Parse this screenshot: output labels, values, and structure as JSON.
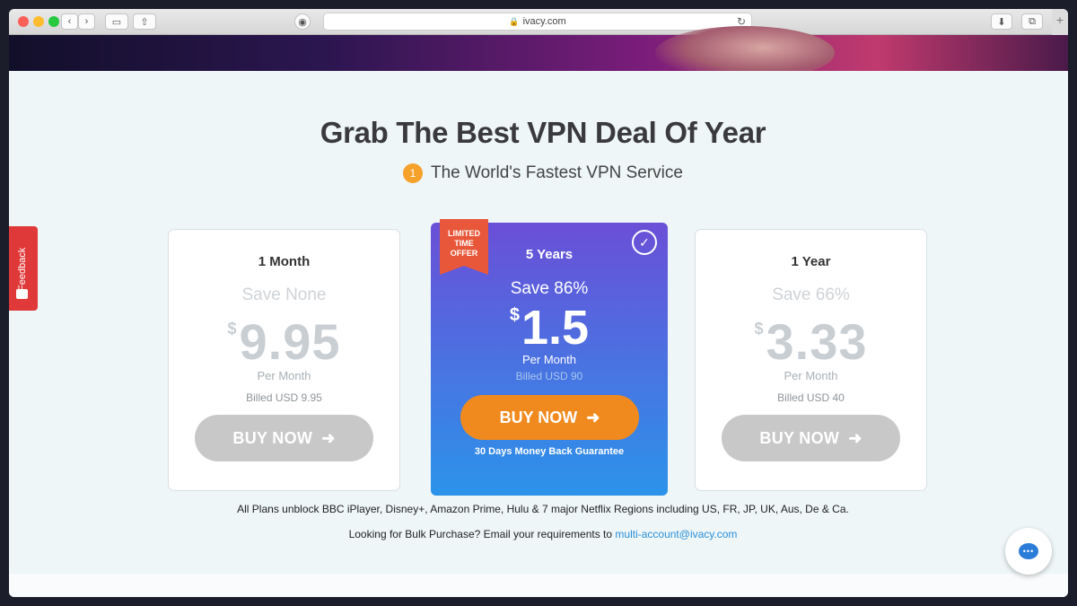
{
  "browser": {
    "url": "ivacy.com",
    "new_tab_label": "+"
  },
  "page": {
    "headline": "Grab The Best VPN Deal Of Year",
    "badge_number": "1",
    "subheadline": "The World's Fastest VPN Service"
  },
  "plans": [
    {
      "period": "1 Month",
      "save": "Save None",
      "currency": "$",
      "price": "9.95",
      "per": "Per Month",
      "billed": "Billed USD 9.95",
      "button": "BUY NOW"
    },
    {
      "period": "5 Years",
      "ribbon": "LIMITED TIME OFFER",
      "save": "Save 86%",
      "currency": "$",
      "price": "1.5",
      "per": "Per Month",
      "billed": "Billed USD 90",
      "button": "BUY NOW",
      "guarantee": "30 Days Money Back Guarantee"
    },
    {
      "period": "1 Year",
      "save": "Save 66%",
      "currency": "$",
      "price": "3.33",
      "per": "Per Month",
      "billed": "Billed USD 40",
      "button": "BUY NOW"
    }
  ],
  "notes": {
    "unblock": "All Plans unblock BBC iPlayer, Disney+, Amazon Prime, Hulu & 7 major Netflix Regions including US, FR, JP, UK, Aus, De & Ca.",
    "bulk_prefix": "Looking for Bulk Purchase? Email your requirements to",
    "bulk_email": "multi-account@ivacy.com"
  },
  "feedback_label": "Feedback",
  "colors": {
    "accent_orange": "#f08a1e",
    "ribbon": "#e8573a",
    "feedback": "#e03939",
    "link": "#2b8fd8"
  }
}
